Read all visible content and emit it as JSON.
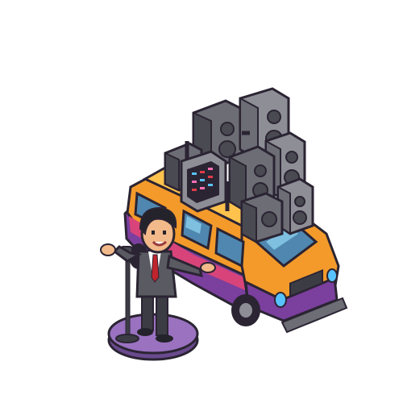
{
  "scene": {
    "background": "#ffffff",
    "sprites": [
      "van",
      "speaker-stack",
      "mixer-console",
      "pedestal",
      "microphone-stand",
      "man-in-suit"
    ]
  },
  "colors": {
    "outline": "#2b2433",
    "van_orange": "#f39a2b",
    "van_light": "#ffc24d",
    "van_pink": "#d8447a",
    "van_purple": "#7b3f9e",
    "glass": "#4f87b0",
    "glass_light": "#7fc0e0",
    "speaker_dark": "#4a4a52",
    "speaker_mid": "#6d6d75",
    "speaker_light": "#8e8e96",
    "pedestal": "#9a72c0",
    "pedestal_dark": "#6a4a8e",
    "suit": "#5a5a62",
    "suit_dark": "#3c3c44",
    "skin": "#f2b98a",
    "hair": "#24222a",
    "tie": "#c0242c",
    "headlight": "#58c2ff"
  }
}
